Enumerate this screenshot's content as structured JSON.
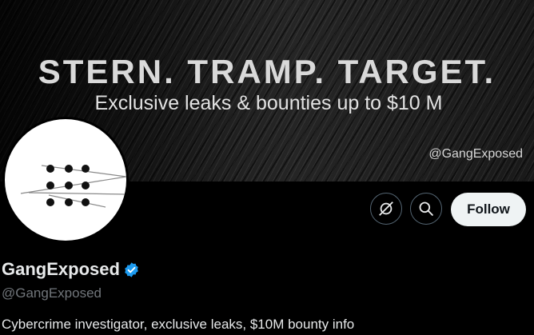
{
  "banner": {
    "headline": "STERN. TRAMP. TARGET.",
    "subline": "Exclusive leaks & bounties up to $10 M",
    "handle_watermark": "@GangExposed"
  },
  "profile": {
    "display_name": "GangExposed",
    "verified": true,
    "handle": "@GangExposed",
    "bio": "Cybercrime investigator, exclusive leaks, $10M bounty info"
  },
  "actions": {
    "grok_icon": "grok-icon",
    "search_icon": "search-icon",
    "follow_label": "Follow"
  },
  "colors": {
    "background": "#000000",
    "follow_button_bg": "#eff3f4",
    "verified_badge": "#1d9bf0",
    "secondary_text": "#71767b"
  }
}
